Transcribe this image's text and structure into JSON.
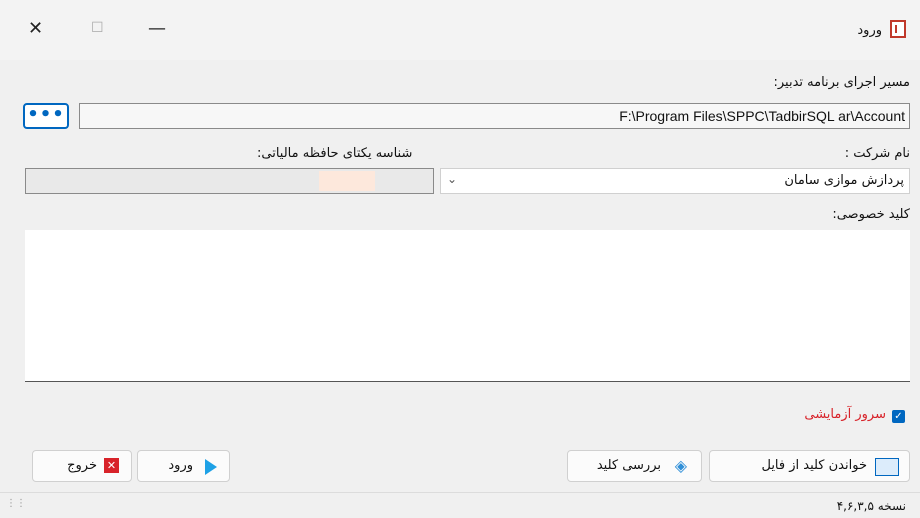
{
  "window": {
    "title": "ورود",
    "controls": {
      "close": "✕",
      "maximize": "☐",
      "minimize": "—"
    }
  },
  "labels": {
    "exec_path": "مسیر اجرای برنامه تدبیر:",
    "company": "نام شرکت :",
    "tax_id": "شناسه یکتای حافظه مالیاتی:",
    "private_key": "کلید خصوصی:"
  },
  "fields": {
    "exec_path_value": "F:\\Program Files\\SPPC\\TadbirSQL ar\\Account",
    "browse_label": "•••",
    "company_value": "پردازش موازی  سامان",
    "tax_id_value": "",
    "private_key_value": ""
  },
  "checkbox": {
    "label": "سرور آزمایشی",
    "checked": true
  },
  "buttons": {
    "read_key_file": "خواندن کلید از فایل",
    "check_key": "بررسی کلید",
    "login": "ورود",
    "exit": "خروج"
  },
  "status": {
    "version": "نسخه ۴,۶,۳,۵"
  },
  "colors": {
    "accent": "#0067c0",
    "danger": "#d8232a"
  },
  "icons": {
    "app": "app-logo-icon",
    "read_key_file": "folder-key-icon",
    "check_key": "key-check-icon",
    "login": "play-arrow-icon",
    "exit": "close-x-icon"
  }
}
